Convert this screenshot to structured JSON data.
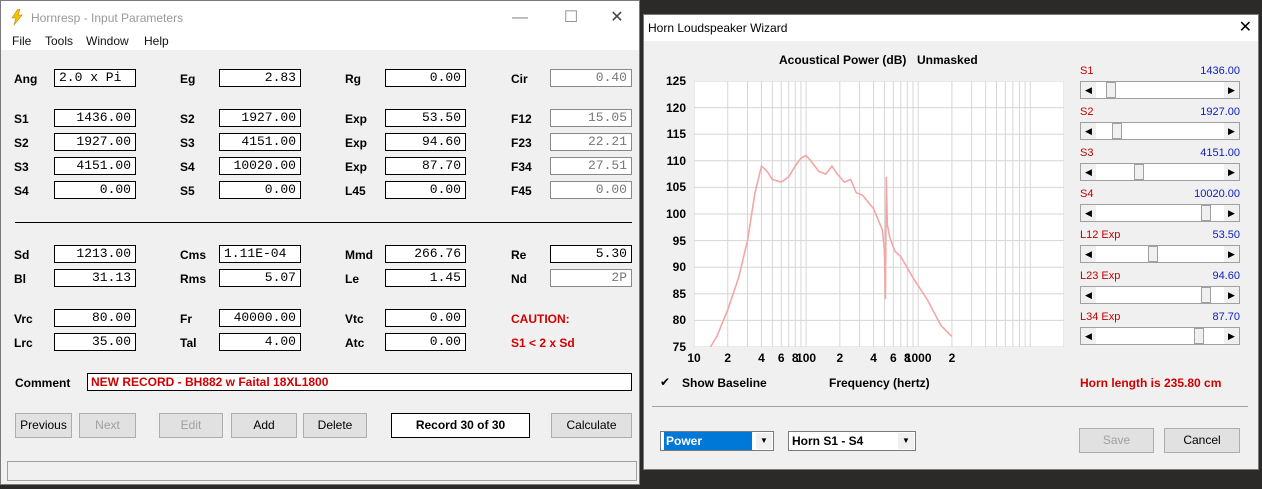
{
  "win1": {
    "title": "Hornresp - Input Parameters",
    "controls": {
      "minimize": "—",
      "maximize": "☐",
      "close": "✕"
    },
    "menu": [
      "File",
      "Tools",
      "Window",
      "Help"
    ],
    "params": {
      "ang": {
        "label": "Ang",
        "value": "2.0 x Pi"
      },
      "eg": {
        "label": "Eg",
        "value": "2.83"
      },
      "rg": {
        "label": "Rg",
        "value": "0.00"
      },
      "cir": {
        "label": "Cir",
        "value": "0.40"
      },
      "s1": {
        "label": "S1",
        "value": "1436.00"
      },
      "s2": {
        "label": "S2",
        "value": "1927.00"
      },
      "exp1": {
        "label": "Exp",
        "value": "53.50"
      },
      "f12": {
        "label": "F12",
        "value": "15.05"
      },
      "s2b": {
        "label": "S2",
        "value": "1927.00"
      },
      "s3": {
        "label": "S3",
        "value": "4151.00"
      },
      "exp2": {
        "label": "Exp",
        "value": "94.60"
      },
      "f23": {
        "label": "F23",
        "value": "22.21"
      },
      "s3b": {
        "label": "S3",
        "value": "4151.00"
      },
      "s4": {
        "label": "S4",
        "value": "10020.00"
      },
      "exp3": {
        "label": "Exp",
        "value": "87.70"
      },
      "f34": {
        "label": "F34",
        "value": "27.51"
      },
      "s4b": {
        "label": "S4",
        "value": "0.00"
      },
      "s5": {
        "label": "S5",
        "value": "0.00"
      },
      "l45": {
        "label": "L45",
        "value": "0.00"
      },
      "f45": {
        "label": "F45",
        "value": "0.00"
      },
      "sd": {
        "label": "Sd",
        "value": "1213.00"
      },
      "cms": {
        "label": "Cms",
        "value": "1.11E-04"
      },
      "mmd": {
        "label": "Mmd",
        "value": "266.76"
      },
      "re": {
        "label": "Re",
        "value": "5.30"
      },
      "bl": {
        "label": "Bl",
        "value": "31.13"
      },
      "rms": {
        "label": "Rms",
        "value": "5.07"
      },
      "le": {
        "label": "Le",
        "value": "1.45"
      },
      "nd": {
        "label": "Nd",
        "value": "2P"
      },
      "vrc": {
        "label": "Vrc",
        "value": "80.00"
      },
      "fr": {
        "label": "Fr",
        "value": "40000.00"
      },
      "vtc": {
        "label": "Vtc",
        "value": "0.00"
      },
      "lrc": {
        "label": "Lrc",
        "value": "35.00"
      },
      "tal": {
        "label": "Tal",
        "value": "4.00"
      },
      "atc": {
        "label": "Atc",
        "value": "0.00"
      }
    },
    "caution_title": "CAUTION:",
    "caution_text": "S1 < 2 x Sd",
    "comment_label": "Comment",
    "comment_value": "NEW RECORD - BH882 w Faital 18XL1800",
    "buttons": {
      "previous": "Previous",
      "next": "Next",
      "edit": "Edit",
      "add": "Add",
      "delete": "Delete",
      "record": "Record 30 of 30",
      "calculate": "Calculate"
    }
  },
  "win2": {
    "title": "Horn Loudspeaker Wizard",
    "close": "✕",
    "chart_title": "Acoustical Power (dB)",
    "chart_mode": "Unmasked",
    "show_baseline": "Show Baseline",
    "xlabel": "Frequency (hertz)",
    "horn_length": "Horn length is 235.80 cm",
    "sliders": [
      {
        "label": "S1",
        "value": "1436.00",
        "pos": 0.08
      },
      {
        "label": "S2",
        "value": "1927.00",
        "pos": 0.13
      },
      {
        "label": "S3",
        "value": "4151.00",
        "pos": 0.32
      },
      {
        "label": "S4",
        "value": "10020.00",
        "pos": 0.9
      },
      {
        "label": "L12  Exp",
        "value": "53.50",
        "pos": 0.44
      },
      {
        "label": "L23  Exp",
        "value": "94.60",
        "pos": 0.9
      },
      {
        "label": "L34  Exp",
        "value": "87.70",
        "pos": 0.84
      }
    ],
    "mode_select": "Power",
    "horn_select": "Horn S1 - S4",
    "buttons": {
      "save": "Save",
      "cancel": "Cancel"
    },
    "check_mark": "✔"
  },
  "chart_data": {
    "type": "line",
    "title": "Acoustical Power (dB)",
    "xlabel": "Frequency (hertz)",
    "ylabel": "",
    "x_scale": "log",
    "xlim": [
      10,
      20000
    ],
    "ylim": [
      75,
      125
    ],
    "x_ticks": [
      "10",
      "2",
      "4",
      "6",
      "8",
      "100",
      "2",
      "4",
      "6",
      "8",
      "1000",
      "2"
    ],
    "y_ticks": [
      125,
      120,
      115,
      110,
      105,
      100,
      95,
      90,
      85,
      80,
      75
    ],
    "grid": true,
    "color": "#f4a6a6",
    "series": [
      {
        "name": "",
        "x": [
          14,
          16,
          20,
          25,
          30,
          35,
          40,
          45,
          50,
          60,
          70,
          80,
          90,
          100,
          110,
          130,
          150,
          170,
          190,
          220,
          250,
          280,
          320,
          400,
          480,
          500,
          510,
          520,
          530,
          560,
          620,
          700,
          900,
          1200,
          1600,
          2000
        ],
        "y": [
          75,
          77,
          82,
          88,
          95,
          104,
          109,
          108,
          106.5,
          106,
          107,
          109,
          110.5,
          111,
          110,
          108,
          107.5,
          109,
          107.5,
          106,
          106.5,
          104,
          103.5,
          101,
          97,
          93,
          84,
          107,
          98,
          95.5,
          93,
          92,
          88,
          84,
          79,
          77
        ]
      }
    ]
  }
}
